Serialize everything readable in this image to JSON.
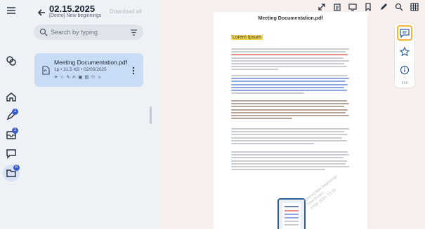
{
  "nav": {
    "items": [
      {
        "icon": "menu-icon"
      },
      {
        "icon": "logo-icon"
      },
      {
        "icon": "home-icon"
      },
      {
        "icon": "sign-icon",
        "badge": "1"
      },
      {
        "icon": "inbox-icon",
        "badge": "2"
      },
      {
        "icon": "chat-icon"
      },
      {
        "icon": "folder-icon",
        "badge": "6"
      }
    ]
  },
  "folder": {
    "date": "02.15.2025",
    "subtitle": "[Demo] New beginnings",
    "download_all": "Download all",
    "search_placeholder": "Search by typing"
  },
  "document_card": {
    "name": "Meeting Documentation.pdf",
    "meta": "1p • 31.5 KB • 02/05/2025",
    "icons": [
      "✈",
      "☆",
      "✎",
      "✍",
      "▣",
      "▤",
      "⚇",
      "☺"
    ]
  },
  "viewer": {
    "doc_title": "Meeting Documentation.pdf",
    "highlight_text": "Lorem Ipsum",
    "stamp_lines": [
      "[Demo] New beginnings",
      "Fred Brown",
      "3 Mar 2025, 13:18"
    ],
    "colors": {
      "highlight": "#f3d35b",
      "selected_tool": "#f4b338",
      "accent": "#3a5bd0"
    },
    "toolbar_icons": [
      "expand-icon",
      "clipboard-icon",
      "monitor-icon",
      "bookmark-icon",
      "pen-icon",
      "search-icon",
      "grid-icon"
    ],
    "side_tools": [
      "comment-icon",
      "star-icon",
      "info-icon"
    ]
  }
}
